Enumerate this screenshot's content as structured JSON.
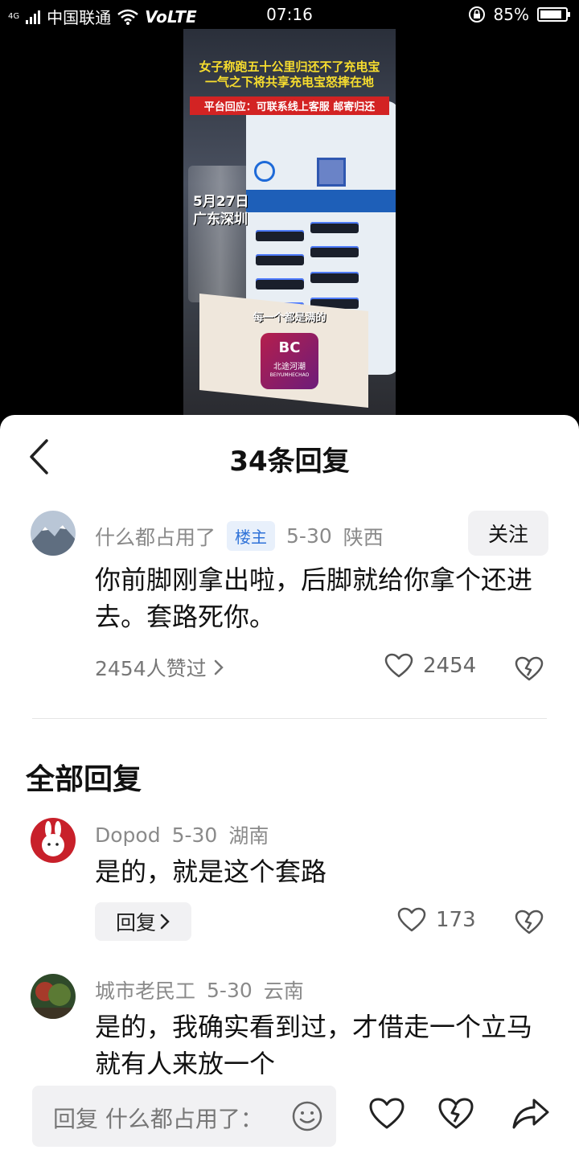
{
  "status_bar": {
    "network_type": "4G",
    "carrier": "中国联通",
    "volte": "VoLTE",
    "time": "07:16",
    "battery": "85%",
    "battery_level": 0.85
  },
  "video": {
    "headline_line1": "女子称跑五十公里归还不了充电宝",
    "headline_line2": "一气之下将共享充电宝怒摔在地",
    "platform_reply": "平台回应：可联系线上客服 邮寄归还",
    "date": "5月27日",
    "location": "广东深圳",
    "subtitle": "每一个都是满的",
    "badge_letters": "BC",
    "badge_name": "北途河潮",
    "badge_en": "BEIYUMHECHAO"
  },
  "sheet": {
    "title": "34条回复"
  },
  "main_comment": {
    "username": "什么都占用了",
    "owner_tag": "楼主",
    "date": "5-30",
    "region": "陕西",
    "follow_label": "关注",
    "text": "你前脚刚拿出啦，后脚就给你拿个还进去。套路死你。",
    "likes_link": "2454人赞过",
    "like_count": "2454"
  },
  "all_replies_title": "全部回复",
  "replies": [
    {
      "username": "Dopod",
      "date": "5-30",
      "region": "湖南",
      "text": "是的，就是这个套路",
      "reply_label": "回复",
      "like_count": "173"
    },
    {
      "username": "城市老民工",
      "date": "5-30",
      "region": "云南",
      "text": "是的，我确实看到过，才借走一个立马就有人来放一个"
    }
  ],
  "bottom_bar": {
    "input_placeholder": "回复 什么都占用了："
  },
  "icons": {
    "back": "chevron-left-icon",
    "like": "heart-outline-icon",
    "dislike": "broken-heart-icon",
    "share": "share-arrow-icon",
    "emoji": "smiley-icon"
  }
}
